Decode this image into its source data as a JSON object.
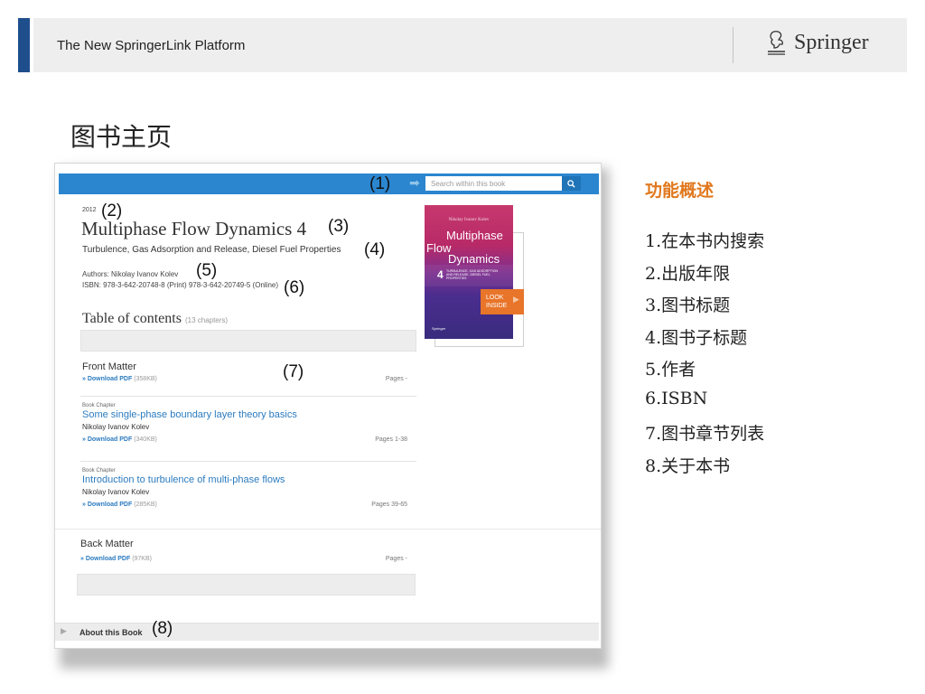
{
  "header": {
    "title": "The New SpringerLink Platform",
    "logo_text": "Springer"
  },
  "slide_title": "图书主页",
  "screenshot": {
    "search": {
      "placeholder": "Search within this book",
      "callout": "(1)"
    },
    "book": {
      "year": "2012",
      "year_callout": "(2)",
      "title": "Multiphase Flow Dynamics 4",
      "title_callout": "(3)",
      "subtitle": "Turbulence, Gas Adsorption and Release, Diesel Fuel Properties",
      "subtitle_callout": "(4)",
      "authors": "Authors: Nikolay Ivanov Kolev",
      "authors_callout": "(5)",
      "isbn": "ISBN: 978-3-642-20748-8 (Print) 978-3-642-20749-5 (Online)",
      "isbn_callout": "(6)"
    },
    "toc": {
      "heading": "Table of contents",
      "count": "(13 chapters)",
      "callout": "(7)",
      "download_label": "» Download PDF",
      "items": [
        {
          "title": "Front Matter",
          "size": "(358KB)",
          "pages": "Pages -"
        },
        {
          "type": "Book Chapter",
          "title": "Some single-phase boundary layer theory basics",
          "author": "Nikolay Ivanov Kolev",
          "size": "(340KB)",
          "pages": "Pages 1-38"
        },
        {
          "type": "Book Chapter",
          "title": "Introduction to turbulence of multi-phase flows",
          "author": "Nikolay Ivanov Kolev",
          "size": "(285KB)",
          "pages": "Pages 39-65"
        }
      ],
      "back_matter": {
        "title": "Back Matter",
        "size": "(97KB)",
        "pages": "Pages -"
      }
    },
    "about": {
      "label": "About this Book",
      "callout": "(8)"
    },
    "cover": {
      "author": "Nikolay Ivanov Kolev",
      "title_line1": "Multiphase",
      "title_line2": "Flow",
      "title_line3": "Dynamics",
      "volume": "4",
      "subtitle": "TURBULENCE, GAS ADSORPTION AND RELEASE, DIESEL FUEL PROPERTIES",
      "publisher": "Springer",
      "look_inside": "LOOK INSIDE"
    }
  },
  "overview": {
    "title": "功能概述",
    "items": [
      "1.在本书内搜索",
      "2.出版年限",
      "3.图书标题",
      "4.图书子标题",
      "5.作者",
      "6.ISBN",
      "7.图书章节列表",
      "8.关于本书"
    ]
  },
  "colors": {
    "accent_bar": "#1f4e8c",
    "topbar": "#2b86cf",
    "link": "#2b7bbf",
    "overview_title": "#e0781e",
    "look_inside": "#e8752a"
  }
}
